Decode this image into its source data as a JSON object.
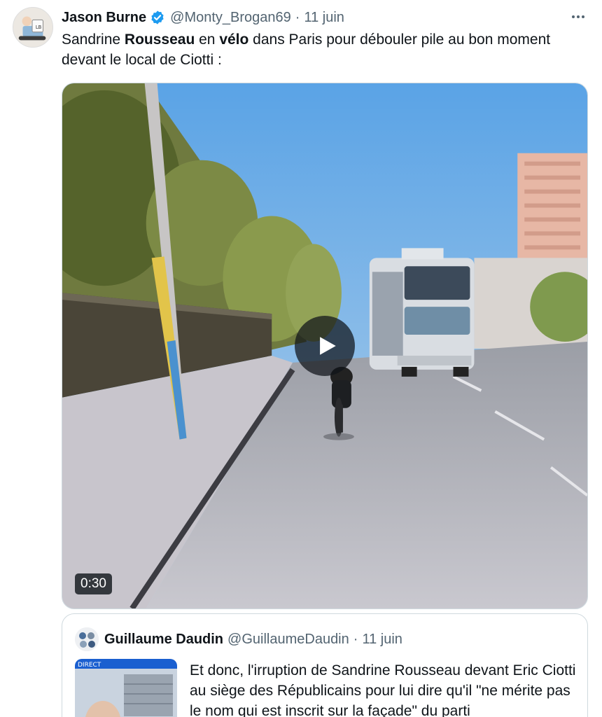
{
  "tweet": {
    "author": {
      "display_name": "Jason Burne",
      "verified_icon": "verified-badge-icon",
      "handle": "@Monty_Brogan69",
      "separator": "·",
      "date": "11 juin"
    },
    "more_icon": "more-options-icon",
    "text": {
      "t1": "Sandrine ",
      "b1": "Rousseau",
      "t2": " en ",
      "b2": "vélo",
      "t3": " dans Paris pour débouler pile au bon moment devant le local de Ciotti :"
    },
    "media": {
      "type": "video",
      "play_icon": "play-icon",
      "duration": "0:30"
    }
  },
  "quoted_tweet": {
    "author": {
      "display_name": "Guillaume Daudin",
      "handle": "@GuillaumeDaudin",
      "separator": "·",
      "date": "11 juin"
    },
    "text": "Et donc, l'irruption de Sandrine Rousseau devant Eric Ciotti au siège des Républicains pour lui dire qu'il \"ne mérite pas le nom qui est inscrit sur la façade\" du parti",
    "thumbnail": "video-thumbnail",
    "thumbnail_badge": "DIRECT"
  },
  "colors": {
    "text_primary": "#0f1419",
    "text_secondary": "#536471",
    "verified_blue": "#1d9bf0",
    "border": "#cfd9de"
  }
}
